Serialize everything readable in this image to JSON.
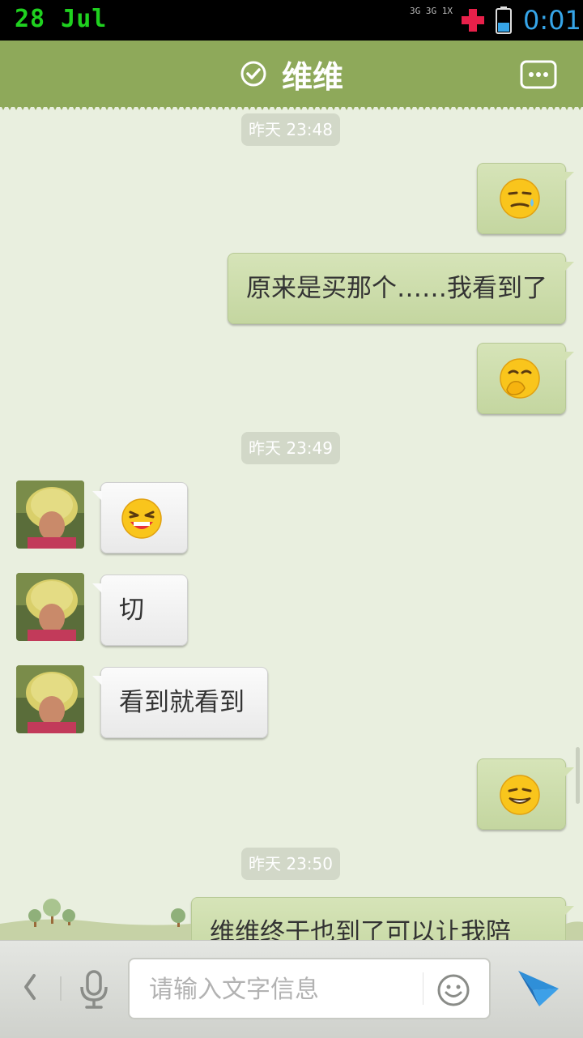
{
  "status_bar": {
    "date": "28 Jul",
    "network": [
      "3G",
      "3G",
      "1X"
    ],
    "time": "0:01"
  },
  "header": {
    "title": "维维",
    "verified_icon": "check-circle-icon",
    "menu_icon": "chat-menu-icon"
  },
  "messages": [
    {
      "type": "timestamp",
      "text": "昨天 23:48"
    },
    {
      "type": "outgoing",
      "emoji": "sweat-smile-emoji"
    },
    {
      "type": "outgoing",
      "text": "原来是买那个……我看到了"
    },
    {
      "type": "outgoing",
      "emoji": "cover-mouth-giggle-emoji"
    },
    {
      "type": "timestamp",
      "text": "昨天 23:49"
    },
    {
      "type": "incoming",
      "emoji": "laughing-emoji"
    },
    {
      "type": "incoming",
      "text": "切"
    },
    {
      "type": "incoming",
      "text": "看到就看到"
    },
    {
      "type": "outgoing",
      "emoji": "grin-emoji"
    },
    {
      "type": "timestamp",
      "text": "昨天 23:50"
    },
    {
      "type": "outgoing",
      "text": "维维终于也到了可以让我陪"
    }
  ],
  "input": {
    "placeholder": "请输入文字信息",
    "value": ""
  },
  "colors": {
    "header": "#8ea95a",
    "chat_bg": "#e9efdf",
    "outgoing_bubble": "#cfdfb0",
    "incoming_bubble": "#f2f2f2",
    "accent_blue": "#36a5e8"
  }
}
